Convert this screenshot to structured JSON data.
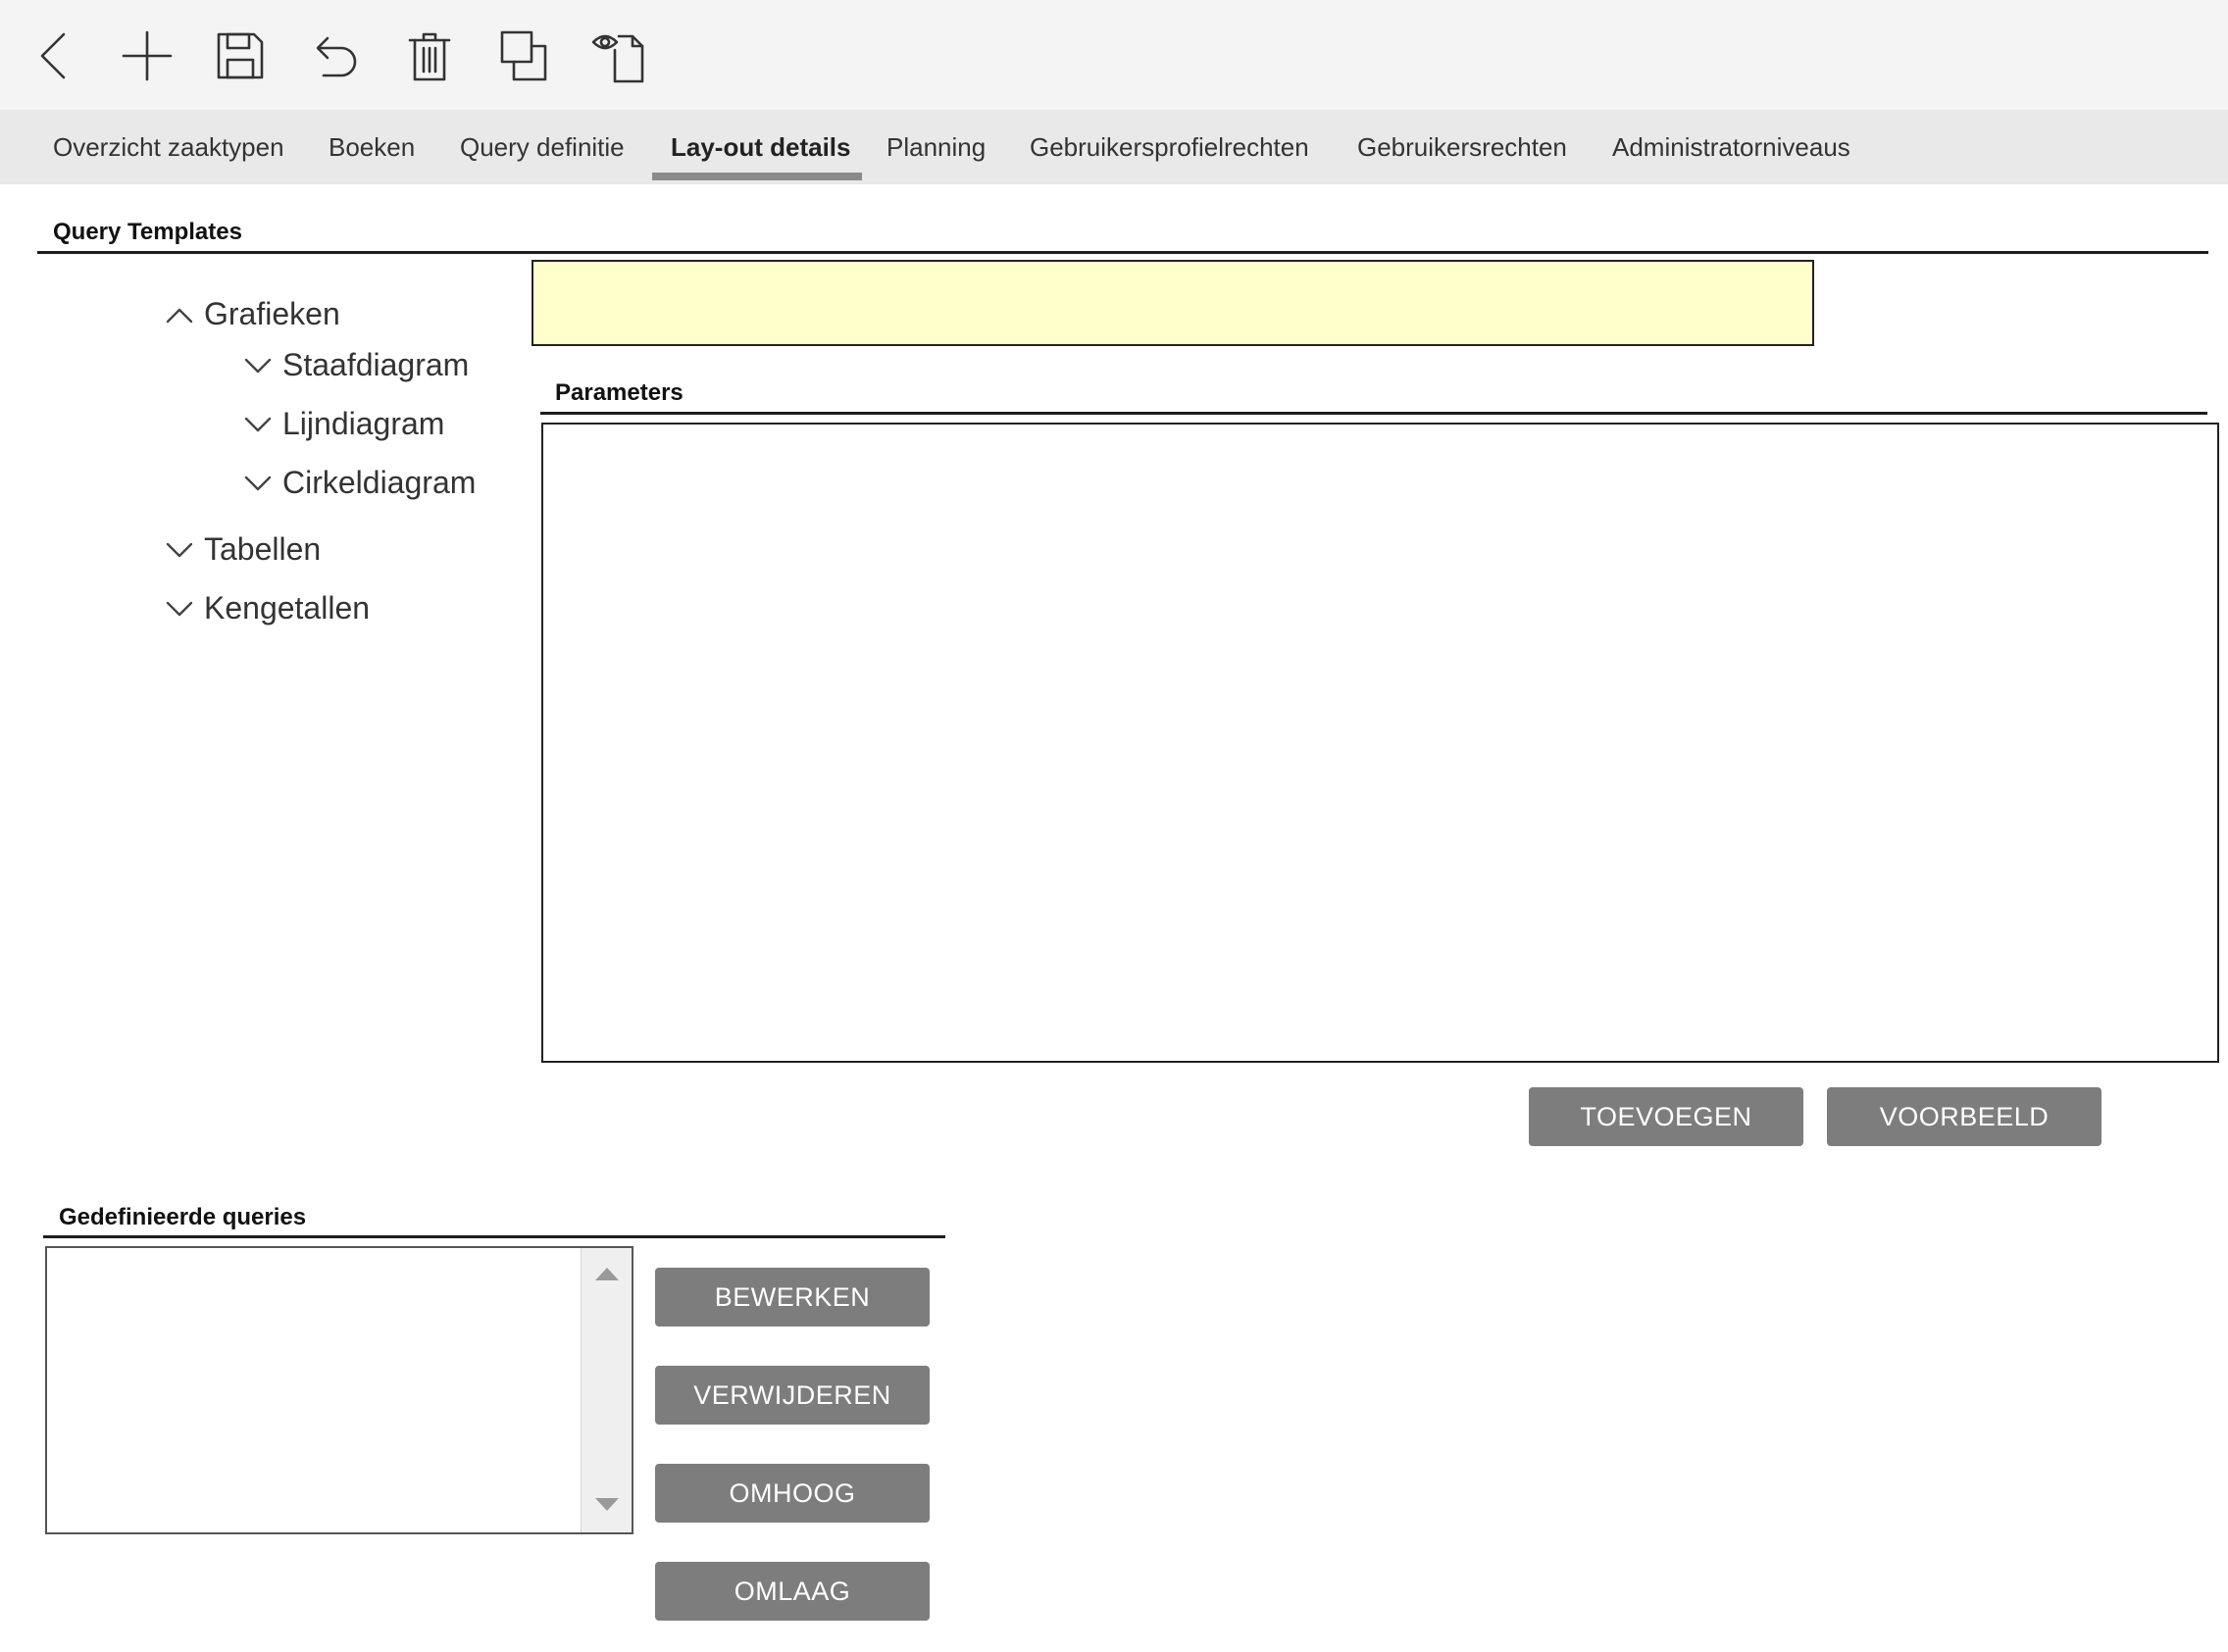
{
  "toolbar": {
    "icons": [
      "back-icon",
      "add-icon",
      "save-icon",
      "undo-icon",
      "delete-icon",
      "copy-icon",
      "preview-icon"
    ]
  },
  "tabs": [
    {
      "label": "Overzicht zaaktypen",
      "active": false
    },
    {
      "label": "Boeken",
      "active": false
    },
    {
      "label": "Query definitie",
      "active": false
    },
    {
      "label": "Lay-out details",
      "active": true
    },
    {
      "label": "Planning",
      "active": false
    },
    {
      "label": "Gebruikersprofielrechten",
      "active": false
    },
    {
      "label": "Gebruikersrechten",
      "active": false
    },
    {
      "label": "Administratorniveaus",
      "active": false
    }
  ],
  "query_templates": {
    "title": "Query Templates",
    "tree": {
      "grafieken": {
        "label": "Grafieken",
        "expanded": true
      },
      "staafdiagram": {
        "label": "Staafdiagram",
        "expanded": false
      },
      "lijndiagram": {
        "label": "Lijndiagram",
        "expanded": false
      },
      "cirkeldiagram": {
        "label": "Cirkeldiagram",
        "expanded": false
      },
      "tabellen": {
        "label": "Tabellen",
        "expanded": false
      },
      "kengetallen": {
        "label": "Kengetallen",
        "expanded": false
      }
    },
    "name_field_value": ""
  },
  "parameters": {
    "title": "Parameters",
    "add_label": "TOEVOEGEN",
    "preview_label": "VOORBEELD"
  },
  "defined_queries": {
    "title": "Gedefinieerde queries",
    "items": [],
    "edit_label": "BEWERKEN",
    "delete_label": "VERWIJDEREN",
    "up_label": "OMHOOG",
    "down_label": "OMLAAG"
  },
  "colors": {
    "toolbar_bg": "#f4f4f4",
    "tabbar_bg": "#e9e9e9",
    "active_tab_underline": "#8a8a8a",
    "field_highlight": "#ffffcc",
    "button_bg": "#7d7d7d"
  }
}
